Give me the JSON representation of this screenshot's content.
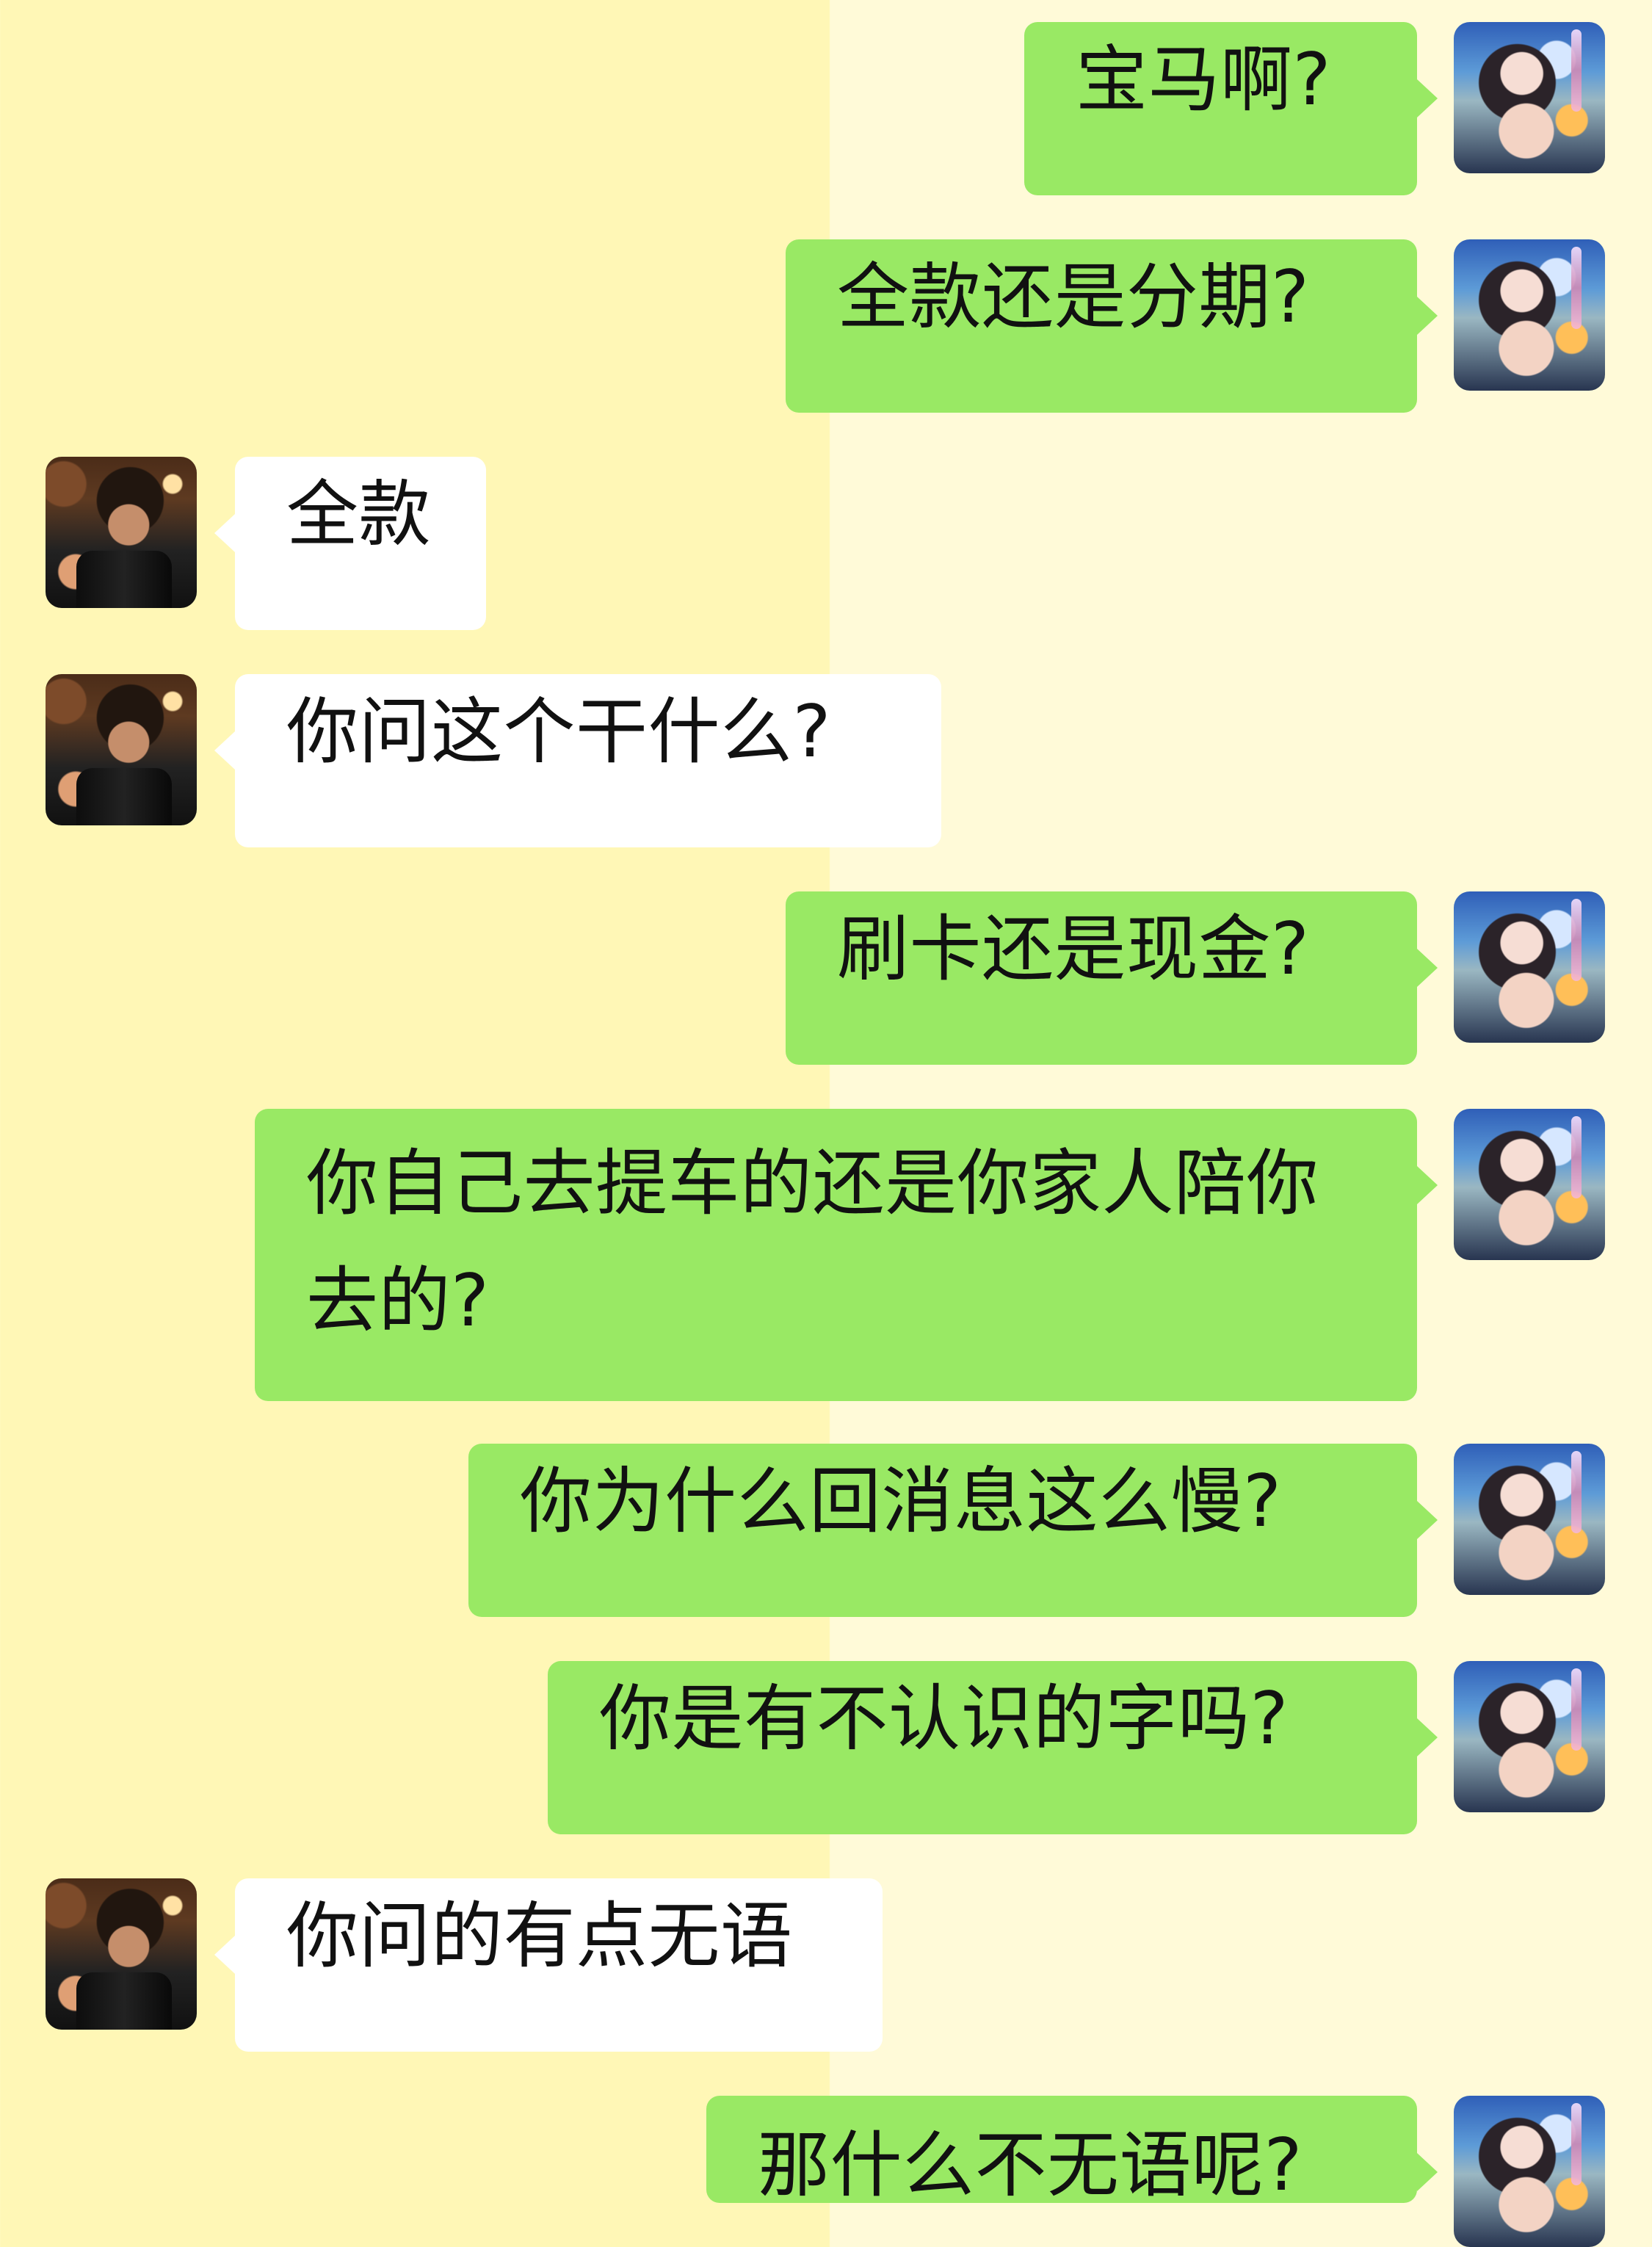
{
  "messages": [
    {
      "side": "outgoing",
      "text": "宝马啊?"
    },
    {
      "side": "outgoing",
      "text": "全款还是分期?"
    },
    {
      "side": "incoming",
      "text": "全款"
    },
    {
      "side": "incoming",
      "text": "你问这个干什么?"
    },
    {
      "side": "outgoing",
      "text": "刷卡还是现金?"
    },
    {
      "side": "outgoing",
      "text": "你自己去提车的还是你家人陪你去的?"
    },
    {
      "side": "outgoing",
      "text": "你为什么回消息这么慢?"
    },
    {
      "side": "outgoing",
      "text": "你是有不认识的字吗?"
    },
    {
      "side": "incoming",
      "text": "你问的有点无语"
    },
    {
      "side": "outgoing",
      "text": "那什么不无语呢?"
    }
  ],
  "colors": {
    "outgoing_bubble": "#99e964",
    "incoming_bubble": "#ffffff",
    "background_left": "#fff7b6",
    "background_right": "#fffad8"
  },
  "icons": {
    "outgoing_avatar": "female-avatar-icon",
    "incoming_avatar": "male-avatar-icon"
  }
}
